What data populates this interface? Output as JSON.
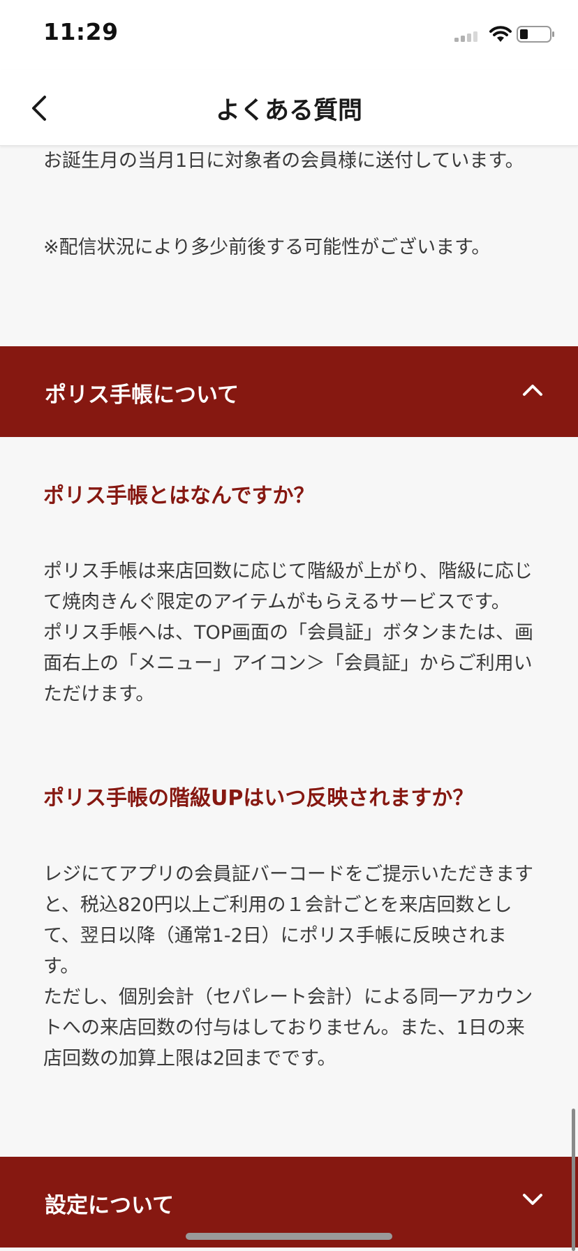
{
  "status_bar": {
    "time": "11:29"
  },
  "nav": {
    "title": "よくある質問"
  },
  "intro": {
    "answer_text": "お誕生月の当月1日に対象者の会員様に送付しています。",
    "note_text": "※配信状況により多少前後する可能性がございます。"
  },
  "section_police": {
    "label": "ポリス手帳について",
    "faqs": [
      {
        "question": "ポリス手帳とはなんですか？",
        "answer": "ポリス手帳は来店回数に応じて階級が上がり、階級に応じて焼肉きんぐ限定のアイテムがもらえるサービスです。\nポリス手帳へは、TOP画面の「会員証」ボタンまたは、画面右上の「メニュー」アイコン＞「会員証」からご利用いただけます。"
      },
      {
        "question": "ポリス手帳の階級UPはいつ反映されますか？",
        "answer": "レジにてアプリの会員証バーコードをご提示いただきますと、税込820円以上ご利用の１会計ごとを来店回数として、翌日以降（通常1-2日）にポリス手帳に反映されます。\nただし、個別会計（セパレート会計）による同一アカウントへの来店回数の付与はしておりません。また、1日の来店回数の加算上限は2回までです。"
      }
    ]
  },
  "section_settings": {
    "label": "設定について"
  },
  "icons": {
    "back": "chevron-left-icon",
    "collapse": "chevron-up-icon",
    "expand": "chevron-down-icon"
  },
  "colors": {
    "accent": "#861811",
    "background": "#f7f7f7"
  }
}
